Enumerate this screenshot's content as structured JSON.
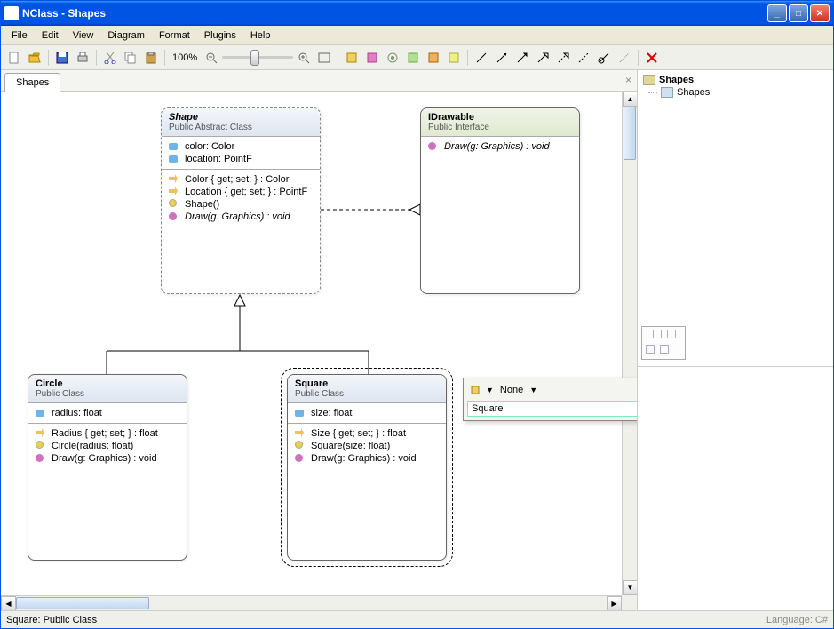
{
  "window": {
    "title": "NClass - Shapes"
  },
  "menubar": [
    "File",
    "Edit",
    "View",
    "Diagram",
    "Format",
    "Plugins",
    "Help"
  ],
  "toolbar": {
    "zoom_label": "100%"
  },
  "tabs": [
    {
      "label": "Shapes"
    }
  ],
  "tree": {
    "root": {
      "label": "Shapes"
    },
    "children": [
      {
        "label": "Shapes"
      }
    ]
  },
  "floating_editor": {
    "access_label": "None",
    "input_value": "Square"
  },
  "statusbar": {
    "text": "Square: Public Class",
    "language": "Language: C#"
  },
  "classes": {
    "shape": {
      "name": "Shape",
      "stereo": "Public Abstract Class",
      "fields": [
        "color: Color",
        "location: PointF"
      ],
      "methods": [
        {
          "icon": "prop",
          "text": "Color { get; set; } : Color"
        },
        {
          "icon": "prop",
          "text": "Location { get; set; } : PointF"
        },
        {
          "icon": "ctor",
          "text": "Shape()"
        },
        {
          "icon": "method",
          "text": "Draw(g: Graphics) : void",
          "italic": true
        }
      ]
    },
    "idrawable": {
      "name": "IDrawable",
      "stereo": "Public Interface",
      "methods": [
        {
          "icon": "method",
          "text": "Draw(g: Graphics) : void",
          "italic": true
        }
      ]
    },
    "circle": {
      "name": "Circle",
      "stereo": "Public Class",
      "fields": [
        "radius: float"
      ],
      "methods": [
        {
          "icon": "prop",
          "text": "Radius { get; set; } : float"
        },
        {
          "icon": "ctor",
          "text": "Circle(radius: float)"
        },
        {
          "icon": "method",
          "text": "Draw(g: Graphics) : void"
        }
      ]
    },
    "square": {
      "name": "Square",
      "stereo": "Public Class",
      "fields": [
        "size: float"
      ],
      "methods": [
        {
          "icon": "prop",
          "text": "Size { get; set; } : float"
        },
        {
          "icon": "ctor",
          "text": "Square(size: float)"
        },
        {
          "icon": "method",
          "text": "Draw(g: Graphics) : void"
        }
      ]
    }
  }
}
